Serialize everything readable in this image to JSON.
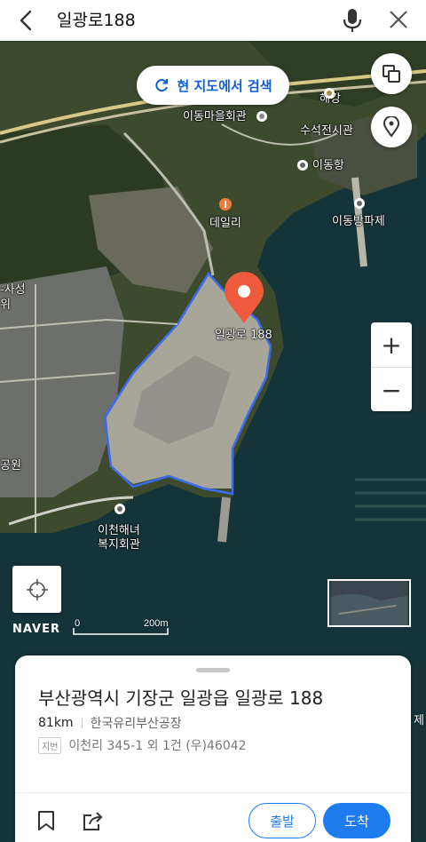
{
  "search": {
    "query": "일광로188"
  },
  "map": {
    "research_label": "현 지도에서 검색",
    "pin_label": "일광로 188",
    "labels": {
      "idong_village": "이동마을회관",
      "haegang_line1": "해강",
      "haegang_line2": "수석전시관",
      "idong_port": "이동항",
      "daily": "데일리",
      "idong_breakwater": "이동방파제",
      "left_edge_line1": "-사성",
      "left_edge_line2": "위",
      "park": "공원",
      "icheon_line1": "이천해녀",
      "icheon_line2": "복지회관"
    },
    "zoom_in": "+",
    "zoom_out": "−",
    "brand": "NAVER",
    "scale_zero": "0",
    "scale_value": "200m",
    "accent": "#1f7cf0",
    "pin_color": "#f05a3c"
  },
  "sheet": {
    "address": "부산광역시 기장군 일광읍 일광로 188",
    "distance": "81km",
    "place": "한국유리부산공장",
    "jibun_tag": "지번",
    "jibun_value": "이천리 345-1 외 1건 (우)46042",
    "depart_label": "출발",
    "arrive_label": "도착"
  },
  "edge_char": "제",
  "icons": [
    "back-icon",
    "mic-icon",
    "close-icon",
    "refresh-icon",
    "layers-icon",
    "location-pin-icon",
    "crosshair-icon",
    "bookmark-icon",
    "share-icon"
  ]
}
